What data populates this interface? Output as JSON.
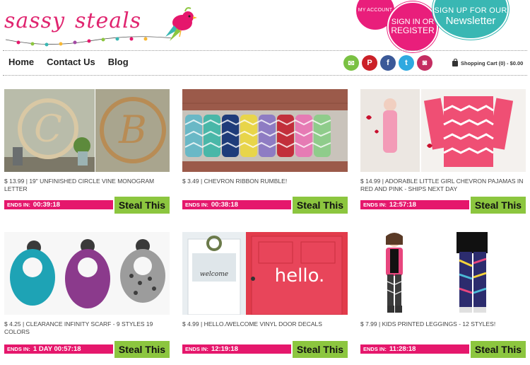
{
  "header": {
    "logo_text_1": "sassy",
    "logo_text_2": "steals",
    "my_account_label": "MY ACCOUNT",
    "sign_in_line1": "SIGN IN OR",
    "sign_in_line2": "REGISTER",
    "newsletter_line1": "SIGN UP FOR OUR",
    "newsletter_line2": "Newsletter"
  },
  "nav": {
    "items": [
      {
        "label": "Home"
      },
      {
        "label": "Contact Us"
      },
      {
        "label": "Blog"
      }
    ]
  },
  "social": {
    "icons": [
      "email-icon",
      "pinterest-icon",
      "facebook-icon",
      "twitter-icon",
      "instagram-icon"
    ]
  },
  "cart": {
    "label": "Shopping Cart (0) - $0.00"
  },
  "colors": {
    "brand_pink": "#e5176c",
    "steal_green": "#8cc63f",
    "newsletter_teal": "#39b7b3"
  },
  "products": [
    {
      "price": "$ 13.99",
      "title": "19\" UNFINISHED CIRCLE VINE MONOGRAM LETTER",
      "ends_label": "ENDS IN:",
      "ends_time": "00:39:18",
      "button": "Steal This"
    },
    {
      "price": "$ 3.49",
      "title": "CHEVRON RIBBON RUMBLE!",
      "ends_label": "ENDS IN:",
      "ends_time": "00:38:18",
      "button": "Steal This"
    },
    {
      "price": "$ 14.99",
      "title": "ADORABLE LITTLE GIRL CHEVRON PAJAMAS IN RED AND PINK - SHIPS NEXT DAY",
      "ends_label": "ENDS IN:",
      "ends_time": "12:57:18",
      "button": "Steal This"
    },
    {
      "price": "$ 4.25",
      "title": "CLEARANCE INFINITY SCARF - 9 STYLES 19 COLORS",
      "ends_label": "ENDS IN:",
      "ends_time": "1 DAY 00:57:18",
      "button": "Steal This"
    },
    {
      "price": "$ 4.99",
      "title": "HELLO./WELCOME VINYL DOOR DECALS",
      "ends_label": "ENDS IN:",
      "ends_time": "12:19:18",
      "button": "Steal This"
    },
    {
      "price": "$ 7.99",
      "title": "KIDS PRINTED LEGGINGS - 12 STYLES!",
      "ends_label": "ENDS IN:",
      "ends_time": "11:28:18",
      "button": "Steal This"
    }
  ],
  "image_text": {
    "monogram_left": "C",
    "monogram_right": "B",
    "door_hello": "hello.",
    "door_welcome": "welcome"
  }
}
